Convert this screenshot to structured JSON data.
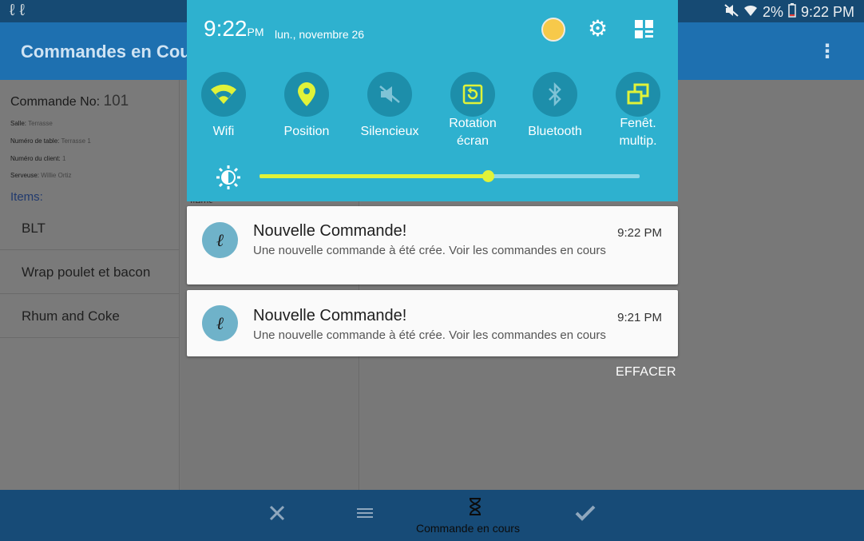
{
  "status_bar": {
    "battery": "2%",
    "time": "9:22 PM"
  },
  "app": {
    "title": "Commandes en Cou",
    "menu_icon": "more-vert-icon",
    "order": {
      "label": "Commande No:",
      "number": "101",
      "fields": [
        {
          "label": "Salle:",
          "value": "Terrasse"
        },
        {
          "label": "Numéro de table:",
          "value": "Terrasse 1"
        },
        {
          "label": "Numéro du client:",
          "value": "1"
        },
        {
          "label": "Serveuse:",
          "value": "Willie Ortiz"
        }
      ],
      "items_label": "Items:",
      "items": [
        "BLT",
        "Wrap poulet et bacon",
        "Rhum and Coke"
      ]
    },
    "peek_label": "Items:",
    "bottom_nav": {
      "active_label": "Commande en cours",
      "icons": [
        "utensils-icon",
        "list-icon",
        "hourglass-icon",
        "check-icon"
      ]
    }
  },
  "quick_settings": {
    "time": "9:22",
    "ampm": "PM",
    "date": "lun., novembre 26",
    "tiles": [
      {
        "label": "Wifi",
        "icon": "wifi-icon",
        "active": true
      },
      {
        "label": "Position",
        "icon": "location-icon",
        "active": true
      },
      {
        "label": "Silencieux",
        "icon": "mute-icon",
        "active": false
      },
      {
        "label": "Rotation écran",
        "label_line1": "Rotation",
        "label_line2": "écran",
        "icon": "rotation-icon",
        "active": true
      },
      {
        "label": "Bluetooth",
        "icon": "bluetooth-icon",
        "active": false
      },
      {
        "label": "Fenêt. multip.",
        "label_line1": "Fenêt.",
        "label_line2": "multip.",
        "icon": "multiwindow-icon",
        "active": true
      }
    ],
    "brightness": 0.6,
    "colors": {
      "accent": "#e0f339",
      "panel": "#2eb1cf",
      "tile": "#1d8eaa"
    }
  },
  "notifications": [
    {
      "title": "Nouvelle Commande!",
      "time": "9:22 PM",
      "text": "Une nouvelle commande à été crée. Voir les commandes en cours"
    },
    {
      "title": "Nouvelle Commande!",
      "time": "9:21 PM",
      "text": "Une nouvelle commande à été crée. Voir les commandes en cours"
    }
  ],
  "clear_button": "EFFACER"
}
